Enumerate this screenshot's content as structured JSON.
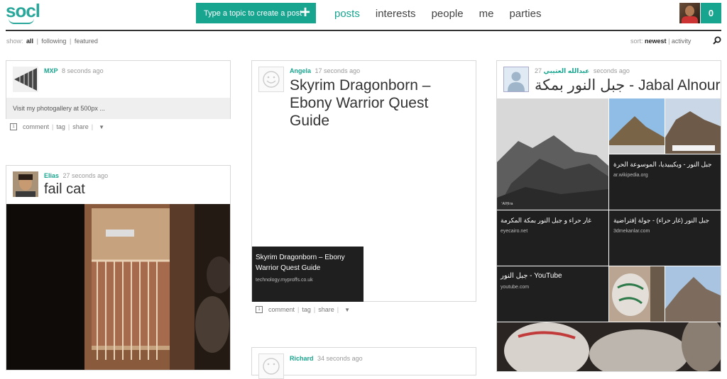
{
  "header": {
    "logo": "socl",
    "create_label": "Type a topic to create a post",
    "create_plus": "+",
    "nav": [
      "posts",
      "interests",
      "people",
      "me",
      "parties"
    ],
    "nav_active": "posts",
    "notification_count": "0"
  },
  "filter": {
    "label": "show:",
    "options": [
      "all",
      "following",
      "featured"
    ],
    "selected": "all"
  },
  "sort": {
    "label": "sort:",
    "options": [
      "newest",
      "activity"
    ],
    "selected": "newest"
  },
  "posts": {
    "mxp": {
      "user": "MXP",
      "time": "8 seconds ago",
      "body": "Visit my photogallery at 500px ..."
    },
    "elias": {
      "user": "Elias",
      "time": "27 seconds ago",
      "title": "fail cat"
    },
    "angela": {
      "user": "Angela",
      "time": "17 seconds ago",
      "title": "Skyrim Dragonborn – Ebony Warrior Quest Guide",
      "link_title": "Skyrim Dragonborn – Ebony Warrior Quest Guide",
      "link_source": "technology.myproffs.co.uk"
    },
    "richard": {
      "user": "Richard",
      "time": "34 seconds ago"
    },
    "arabic": {
      "user": "عبدالله العتيبي",
      "time": "27 seconds ago",
      "title": "جبل النور بمكة - Jabal Alnour",
      "tiles": [
        {
          "title": "جبل النور - ويكيبيديا، الموسوعة الحرة",
          "source": "ar.wikipedia.org"
        },
        {
          "title": "غار حراء و جبل النور بمكة المكرمة",
          "source": "eyecairo.net"
        },
        {
          "title": "جبل النور (غار حراء) - جولة إفتراضية",
          "source": "3dmekanlar.com"
        },
        {
          "title": "جبل النور - YouTube",
          "source": "youtube.com"
        }
      ]
    }
  },
  "actions": {
    "comment": "comment",
    "tag": "tag",
    "share": "share",
    "more": "▼"
  },
  "colors": {
    "accent": "#17a58f",
    "tile_bg": "#1f1f1f"
  }
}
